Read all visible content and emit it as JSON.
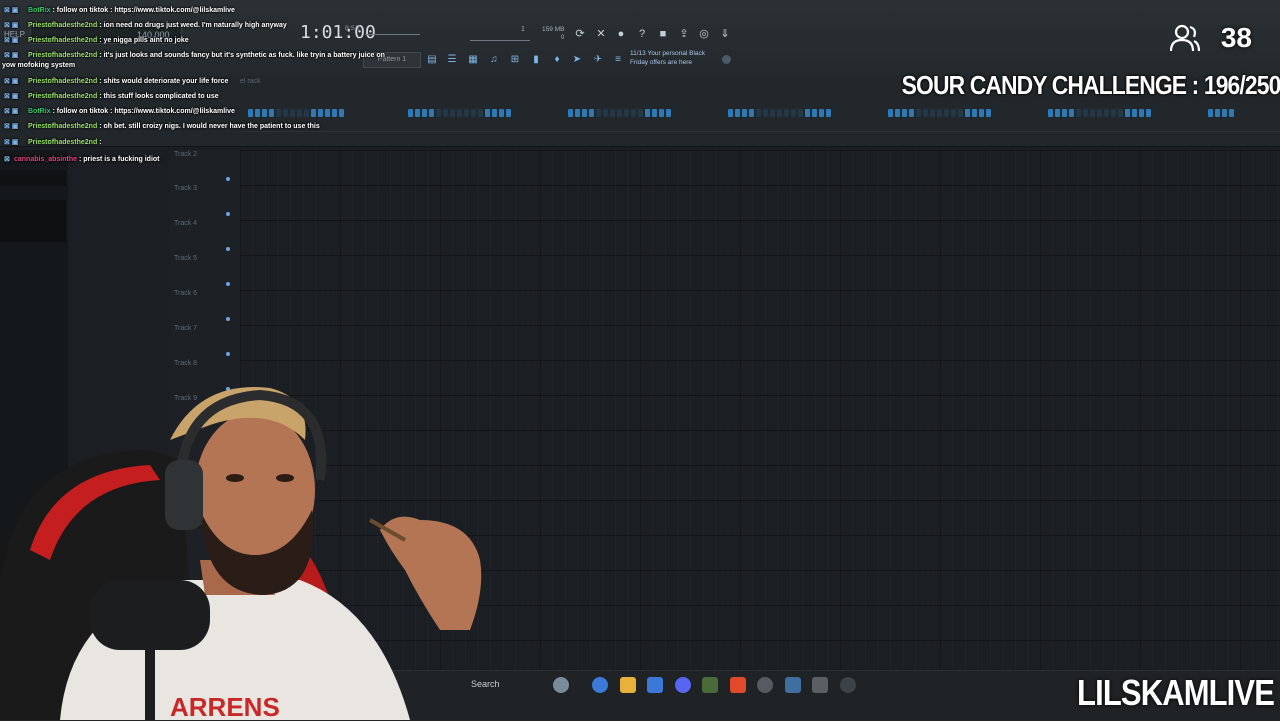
{
  "toolbar": {
    "menu_label": "HELP",
    "tempo": "140.000",
    "time_display": "1:01:00",
    "time_sub": "B:S:T",
    "cpu": "1",
    "memory": "159 MB",
    "memory_sub": "0",
    "pattern_label": "Pattern 1",
    "news_lines": [
      "11/13  Your personal Black",
      "Friday offers are here"
    ],
    "right_icons": [
      "refresh-icon",
      "close-icon",
      "mic-icon",
      "help-icon",
      "save-icon",
      "export-icon",
      "chat-icon",
      "download-icon"
    ],
    "row2_icons": [
      "playlist-icon",
      "mixer-icon",
      "channel-rack-icon",
      "piano-roll-icon",
      "browser-icon",
      "plugin-icon",
      "tool-icon",
      "send-icon",
      "cart-icon"
    ]
  },
  "playlist": {
    "channel_rack_hint": "el rack",
    "tracks": [
      "Track 2",
      "Track 3",
      "Track 4",
      "Track 5",
      "Track 6",
      "Track 7",
      "Track 8",
      "Track 9"
    ]
  },
  "chat": [
    {
      "user": "BotRix",
      "color": "green",
      "text": ": follow on tiktok : https://www.tiktok.com/@lilskamlive"
    },
    {
      "user": "Priestofhadesthe2nd",
      "color": "lime",
      "text": ": ion need no drugs just weed. I'm naturally high anyway"
    },
    {
      "user": "Priestofhadesthe2nd",
      "color": "lime",
      "text": ": ye nigga pills aint no joke"
    },
    {
      "user": "Priestofhadesthe2nd",
      "color": "lime",
      "text": ": it's just looks and sounds fancy but it's synthetic as fuck. like tryin a battery juice on"
    },
    {
      "user": "",
      "color": "lime",
      "text": "yow mofoking system"
    },
    {
      "user": "Priestofhadesthe2nd",
      "color": "lime",
      "text": ": shits would deteriorate your life force"
    },
    {
      "user": "Priestofhadesthe2nd",
      "color": "lime",
      "text": ": this stuff looks complicated to use"
    },
    {
      "user": "BotRix",
      "color": "green",
      "text": ": follow on tiktok : https://www.tiktok.com/@lilskamlive"
    },
    {
      "user": "Priestofhadesthe2nd",
      "color": "lime",
      "text": ": oh bet. still croizy nigs. I would never have the patient to use this"
    },
    {
      "user": "Priestofhadesthe2nd",
      "color": "lime",
      "text": ":"
    },
    {
      "user": "cannabis_absinthe",
      "color": "red",
      "text": ": priest is a fucking idiot"
    }
  ],
  "overlay": {
    "viewer_count": "38",
    "challenge": "SOUR CANDY CHALLENGE : 196/250",
    "channel_name": "LILSKAMLIVE"
  },
  "taskbar": {
    "search_label": "Search",
    "icons": [
      {
        "name": "copilot-icon",
        "color": "#7a8b9a"
      },
      {
        "name": "edge-icon",
        "color": "#3b7bd8"
      },
      {
        "name": "file-explorer-icon",
        "color": "#e8b23a"
      },
      {
        "name": "store-icon",
        "color": "#3c78d8"
      },
      {
        "name": "discord-icon",
        "color": "#5865f2"
      },
      {
        "name": "app-icon",
        "color": "#4a6a3a"
      },
      {
        "name": "brave-icon",
        "color": "#e0492a"
      },
      {
        "name": "fl-studio-icon",
        "color": "#555b60"
      },
      {
        "name": "steam-icon",
        "color": "#3e6fa0"
      },
      {
        "name": "app2-icon",
        "color": "#5a5f63"
      },
      {
        "name": "4k-icon",
        "color": "#3d4246"
      }
    ]
  }
}
